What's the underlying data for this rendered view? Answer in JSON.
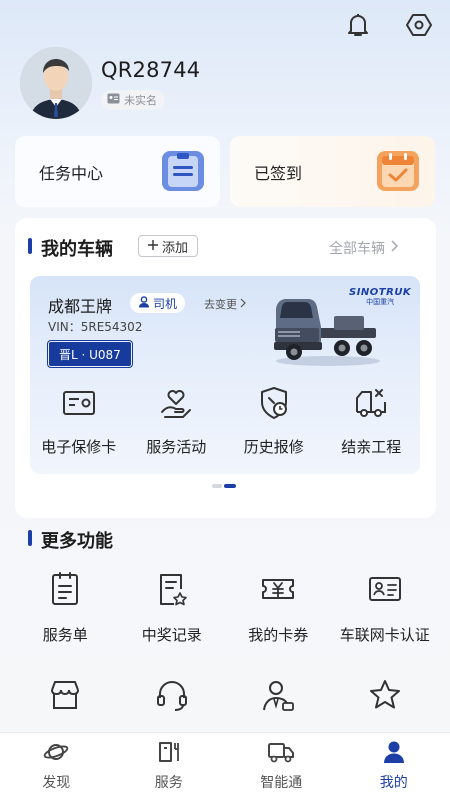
{
  "header": {
    "bell_icon": "bell-icon",
    "settings_icon": "settings-icon"
  },
  "profile": {
    "username": "QR28744",
    "verify_status": "未实名"
  },
  "quick_cards": [
    {
      "label": "任务中心",
      "icon": "clipboard-icon"
    },
    {
      "label": "已签到",
      "icon": "calendar-check-icon"
    }
  ],
  "vehicles": {
    "title": "我的车辆",
    "add_label": "添加",
    "all_label": "全部车辆",
    "card": {
      "name": "成都王牌",
      "role": "司机",
      "change_label": "去变更",
      "vin": "VIN：5RE54302",
      "plate": "晋L · U087",
      "brand_en": "SINOTRUK",
      "brand_cn": "中国重汽"
    },
    "functions": [
      {
        "label": "电子保修卡",
        "icon": "warranty-card-icon"
      },
      {
        "label": "服务活动",
        "icon": "heart-hand-icon"
      },
      {
        "label": "历史报修",
        "icon": "shield-clock-icon"
      },
      {
        "label": "结亲工程",
        "icon": "truck-wrench-icon"
      }
    ]
  },
  "more": {
    "title": "更多功能",
    "items": [
      {
        "label": "服务单",
        "icon": "document-list-icon"
      },
      {
        "label": "中奖记录",
        "icon": "award-record-icon"
      },
      {
        "label": "我的卡券",
        "icon": "coupon-yen-icon"
      },
      {
        "label": "车联网卡认证",
        "icon": "id-card-icon"
      },
      {
        "label": "",
        "icon": "store-icon"
      },
      {
        "label": "",
        "icon": "headset-icon"
      },
      {
        "label": "",
        "icon": "user-manager-icon"
      },
      {
        "label": "",
        "icon": "star-badge-icon"
      }
    ]
  },
  "tabbar": [
    {
      "label": "发现",
      "icon": "planet-icon",
      "active": false
    },
    {
      "label": "服务",
      "icon": "service-icon",
      "active": false
    },
    {
      "label": "智能通",
      "icon": "truck-icon",
      "active": false
    },
    {
      "label": "我的",
      "icon": "person-icon",
      "active": true
    }
  ],
  "colors": {
    "accent": "#1b3fa6",
    "icon_stroke": "#333333"
  }
}
